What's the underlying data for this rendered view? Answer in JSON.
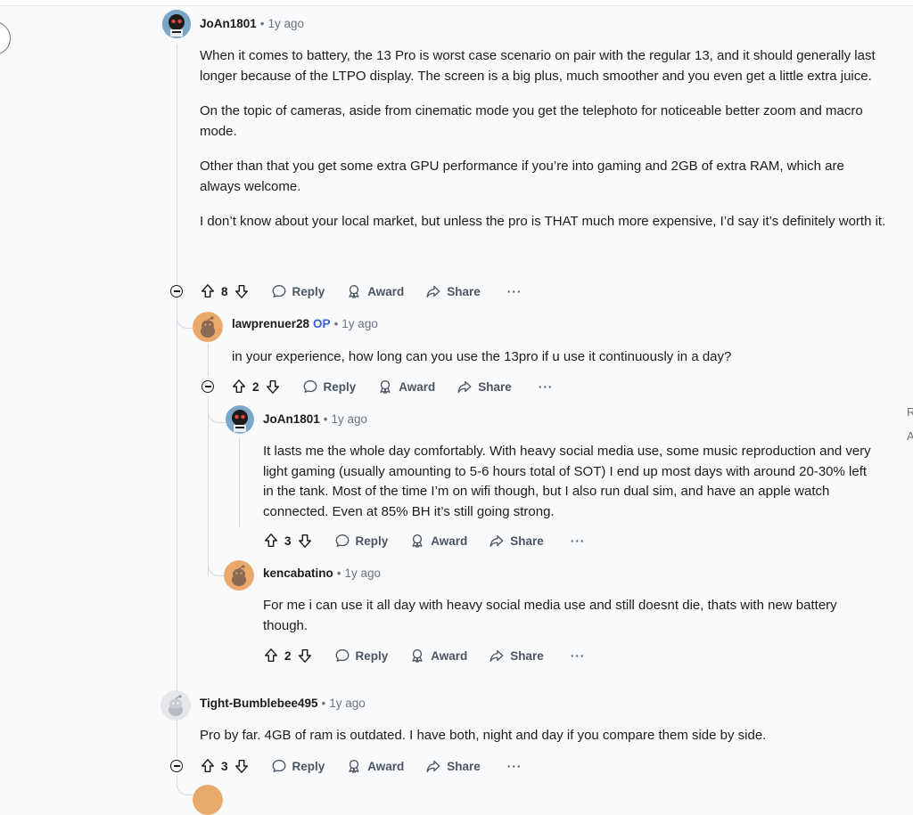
{
  "comments": [
    {
      "author": "JoAn1801",
      "time": "1y ago",
      "paragraphs": [
        "When it comes to battery, the 13 Pro is worst case scenario on pair with the regular 13, and it should generally last longer because of the LTPO display. The screen is a big plus, much smoother and you even get a little extra juice.",
        "On the topic of cameras, aside from cinematic mode you get the telephoto for noticeable better zoom and macro mode.",
        "Other than that you get some extra GPU performance if you’re into gaming and 2GB of extra RAM, which are always welcome.",
        "I don’t know about your local market, but unless the pro is THAT much more expensive, I’d say it’s definitely worth it."
      ],
      "score": "8"
    },
    {
      "author": "lawprenuer28",
      "badge": "OP",
      "time": "1y ago",
      "paragraphs": [
        "in your experience, how long can you use the 13pro if u use it continuously in a day?"
      ],
      "score": "2"
    },
    {
      "author": "JoAn1801",
      "time": "1y ago",
      "paragraphs": [
        "It lasts me the whole day comfortably. With heavy social media use, some music reproduction and very light gaming (usually amounting to 5-6 hours total of SOT) I end up most days with around 20-30% left in the tank. Most of the time I’m on wifi though, but I also run dual sim, and have an apple watch connected. Even at 85% BH it’s still going strong."
      ],
      "score": "3"
    },
    {
      "author": "kencabatino",
      "time": "1y ago",
      "paragraphs": [
        "For me i can use it all day with heavy social media use and still doesnt die, thats with new battery though."
      ],
      "score": "2"
    },
    {
      "author": "Tight-Bumblebee495",
      "time": "1y ago",
      "paragraphs": [
        "Pro by far. 4GB of ram is outdated. I have both, night and day if you compare them side by side."
      ],
      "score": "3"
    }
  ],
  "actions": {
    "reply": "Reply",
    "award": "Award",
    "share": "Share",
    "more": "···"
  },
  "edge_text": [
    "R",
    "A"
  ],
  "colors": {
    "background": "#f9fafb",
    "op_badge": "#3b5bdb",
    "avatar_orange": "#e9a96a",
    "thread_line": "#d4d7dc"
  },
  "icons": [
    "upvote-icon",
    "downvote-icon",
    "reply-bubble-icon",
    "award-icon",
    "share-arrow-icon",
    "collapse-icon"
  ]
}
